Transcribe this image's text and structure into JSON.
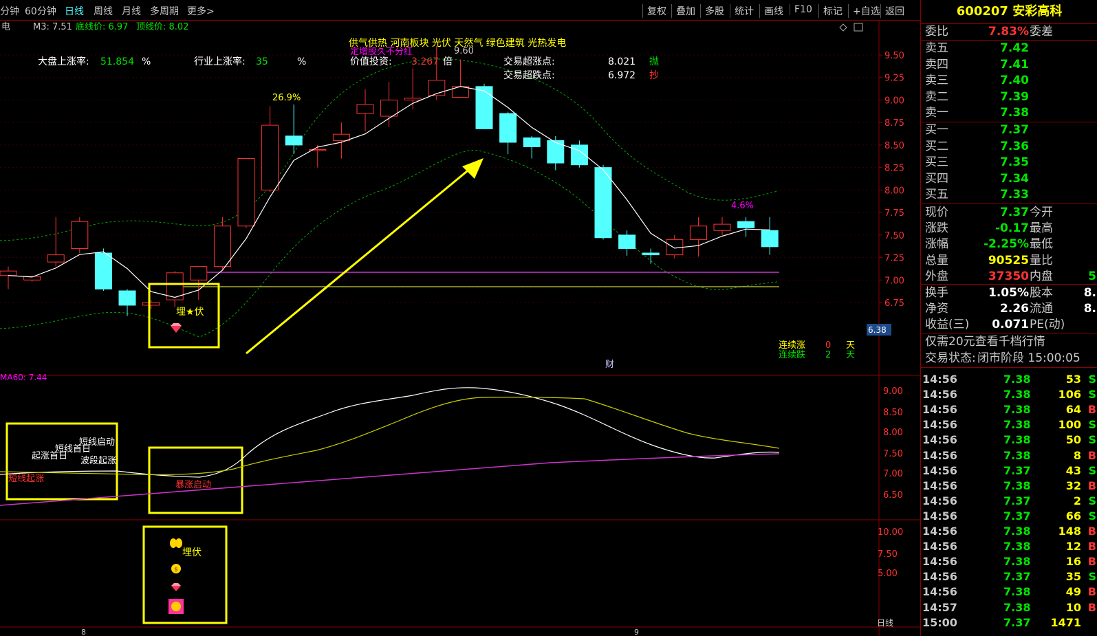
{
  "toolbar": {
    "periods": [
      "分钟",
      "60分钟",
      "日线",
      "周线",
      "月线",
      "多周期",
      "更多>"
    ],
    "active_period": "日线",
    "tools": [
      "复权",
      "叠加",
      "多股",
      "统计",
      "画线",
      "F10",
      "标记",
      "+自选",
      "返回"
    ]
  },
  "main_chart": {
    "name_prefix": "电",
    "ma_label": "M3: 7.51",
    "bottom_label": "底线价: 6.97",
    "top_label": "顶线价: 8.02",
    "market_up_label": "大盘上涨率:",
    "market_up_value": "51.854",
    "market_up_unit": "%",
    "industry_up_label": "行业上涨率:",
    "industry_up_value": "35",
    "industry_up_unit": "%",
    "concepts": "供气供热   河南板块   光伏 天然气 绿色建筑 光热发电",
    "concept_overlay": "定增股久不分红",
    "value_label": "价值投资:",
    "value_number": "3.267",
    "value_unit": "倍",
    "high_mark": "9.60",
    "overbought_label": "交易超涨点:",
    "overbought_value": "8.021",
    "overbought_tag": "抛",
    "oversold_label": "交易超跌点:",
    "oversold_value": "6.972",
    "oversold_tag": "抄",
    "pct_high": "26.9%",
    "pct_low": "4.6%",
    "bury_label": "埋★伏",
    "price_tag": "6.38",
    "streak_up_label": "连续涨",
    "streak_up_value": "0",
    "streak_up_unit": "天",
    "streak_down_label": "连续跌",
    "streak_down_value": "2",
    "streak_down_unit": "天",
    "finance_mark": "财",
    "axis": [
      "9.50",
      "9.25",
      "9.00",
      "8.75",
      "8.50",
      "8.25",
      "8.00",
      "7.75",
      "7.50",
      "7.25",
      "7.00",
      "6.75"
    ]
  },
  "sub_chart": {
    "ma_label": "MA60: 7.44",
    "labels_white": [
      "短线首日",
      "短线启动",
      "起涨首日",
      "波段起涨"
    ],
    "label_red": "短线起涨",
    "burst_label": "暴涨启动",
    "axis": [
      "9.00",
      "8.50",
      "8.00",
      "7.50",
      "7.00",
      "6.50"
    ]
  },
  "third_chart": {
    "bury_label": "埋伏",
    "axis": [
      "10.00",
      "7.50",
      "5.00"
    ],
    "period_tag": "日线",
    "date_marks": [
      "8",
      "9"
    ]
  },
  "chart_data": {
    "type": "candlestick",
    "title": "",
    "ylim": [
      6.5,
      9.75
    ],
    "candles": [
      {
        "o": 7.05,
        "h": 7.15,
        "l": 6.9,
        "c": 7.1
      },
      {
        "o": 7.0,
        "h": 7.05,
        "l": 6.98,
        "c": 7.04
      },
      {
        "o": 7.2,
        "h": 7.7,
        "l": 7.15,
        "c": 7.28
      },
      {
        "o": 7.35,
        "h": 7.7,
        "l": 7.3,
        "c": 7.65
      },
      {
        "o": 7.3,
        "h": 7.35,
        "l": 6.88,
        "c": 6.9
      },
      {
        "o": 6.88,
        "h": 6.9,
        "l": 6.6,
        "c": 6.72
      },
      {
        "o": 6.72,
        "h": 6.78,
        "l": 6.68,
        "c": 6.75
      },
      {
        "o": 6.78,
        "h": 7.1,
        "l": 6.7,
        "c": 7.08
      },
      {
        "o": 7.0,
        "h": 7.15,
        "l": 6.78,
        "c": 7.15
      },
      {
        "o": 7.15,
        "h": 7.7,
        "l": 7.12,
        "c": 7.6
      },
      {
        "o": 7.6,
        "h": 8.35,
        "l": 7.58,
        "c": 8.35
      },
      {
        "o": 8.0,
        "h": 8.93,
        "l": 7.98,
        "c": 8.72
      },
      {
        "o": 8.6,
        "h": 8.95,
        "l": 8.4,
        "c": 8.5
      },
      {
        "o": 8.45,
        "h": 8.5,
        "l": 8.25,
        "c": 8.45
      },
      {
        "o": 8.55,
        "h": 8.75,
        "l": 8.35,
        "c": 8.62
      },
      {
        "o": 8.85,
        "h": 9.12,
        "l": 8.65,
        "c": 8.95
      },
      {
        "o": 8.82,
        "h": 9.2,
        "l": 8.7,
        "c": 9.0
      },
      {
        "o": 9.0,
        "h": 9.35,
        "l": 8.9,
        "c": 9.02
      },
      {
        "o": 9.05,
        "h": 9.6,
        "l": 9.0,
        "c": 9.22
      },
      {
        "o": 9.03,
        "h": 9.45,
        "l": 9.03,
        "c": 9.15
      },
      {
        "o": 9.15,
        "h": 9.18,
        "l": 8.68,
        "c": 8.68
      },
      {
        "o": 8.85,
        "h": 8.87,
        "l": 8.4,
        "c": 8.53
      },
      {
        "o": 8.58,
        "h": 8.6,
        "l": 8.35,
        "c": 8.48
      },
      {
        "o": 8.55,
        "h": 8.6,
        "l": 8.22,
        "c": 8.3
      },
      {
        "o": 8.5,
        "h": 8.55,
        "l": 8.25,
        "c": 8.28
      },
      {
        "o": 8.25,
        "h": 8.28,
        "l": 7.45,
        "c": 7.47
      },
      {
        "o": 7.5,
        "h": 7.55,
        "l": 7.27,
        "c": 7.35
      },
      {
        "o": 7.3,
        "h": 7.35,
        "l": 7.18,
        "c": 7.28
      },
      {
        "o": 7.28,
        "h": 7.5,
        "l": 7.24,
        "c": 7.45
      },
      {
        "o": 7.45,
        "h": 7.7,
        "l": 7.26,
        "c": 7.6
      },
      {
        "o": 7.55,
        "h": 7.7,
        "l": 7.5,
        "c": 7.62
      },
      {
        "o": 7.65,
        "h": 7.7,
        "l": 7.48,
        "c": 7.58
      },
      {
        "o": 7.55,
        "h": 7.7,
        "l": 7.28,
        "c": 7.37
      }
    ]
  },
  "quote": {
    "code": "600207",
    "name": "安彩高科",
    "webi_label": "委比",
    "webi_value": "7.83%",
    "wecha_label": "委差",
    "asks": [
      {
        "label": "卖五",
        "price": "7.42"
      },
      {
        "label": "卖四",
        "price": "7.41"
      },
      {
        "label": "卖三",
        "price": "7.40"
      },
      {
        "label": "卖二",
        "price": "7.39"
      },
      {
        "label": "卖一",
        "price": "7.38"
      }
    ],
    "bids": [
      {
        "label": "买一",
        "price": "7.37"
      },
      {
        "label": "买二",
        "price": "7.36"
      },
      {
        "label": "买三",
        "price": "7.35"
      },
      {
        "label": "买四",
        "price": "7.34"
      },
      {
        "label": "买五",
        "price": "7.33"
      }
    ],
    "stats": [
      {
        "l1": "现价",
        "v1": "7.37",
        "c1": "green",
        "l2": "今开",
        "v2": ""
      },
      {
        "l1": "涨跌",
        "v1": "-0.17",
        "c1": "green",
        "l2": "最高",
        "v2": ""
      },
      {
        "l1": "涨幅",
        "v1": "-2.25%",
        "c1": "green",
        "l2": "最低",
        "v2": ""
      },
      {
        "l1": "总量",
        "v1": "90525",
        "c1": "yellow",
        "l2": "量比",
        "v2": ""
      },
      {
        "l1": "外盘",
        "v1": "37350",
        "c1": "red",
        "l2": "内盘",
        "v2": "5"
      }
    ],
    "stats2": [
      {
        "l1": "换手",
        "v1": "1.05%",
        "c1": "white",
        "l2": "股本",
        "v2": "8."
      },
      {
        "l1": "净资",
        "v1": "2.26",
        "c1": "white",
        "l2": "流通",
        "v2": "8."
      },
      {
        "l1": "收益(三)",
        "v1": "0.071",
        "c1": "white",
        "l2": "PE(动)",
        "v2": ""
      }
    ],
    "promo": "仅需20元查看千档行情",
    "status_label": "交易状态:",
    "status_value": "闭市阶段 15:00:05",
    "ticks": [
      {
        "t": "14:56",
        "p": "7.38",
        "v": "53",
        "d": "S"
      },
      {
        "t": "14:56",
        "p": "7.38",
        "v": "106",
        "d": "S"
      },
      {
        "t": "14:56",
        "p": "7.38",
        "v": "64",
        "d": "B"
      },
      {
        "t": "14:56",
        "p": "7.38",
        "v": "100",
        "d": "S"
      },
      {
        "t": "14:56",
        "p": "7.38",
        "v": "50",
        "d": "S"
      },
      {
        "t": "14:56",
        "p": "7.38",
        "v": "8",
        "d": "B"
      },
      {
        "t": "14:56",
        "p": "7.37",
        "v": "43",
        "d": "S"
      },
      {
        "t": "14:56",
        "p": "7.38",
        "v": "32",
        "d": "B"
      },
      {
        "t": "14:56",
        "p": "7.37",
        "v": "2",
        "d": "S"
      },
      {
        "t": "14:56",
        "p": "7.37",
        "v": "66",
        "d": "S"
      },
      {
        "t": "14:56",
        "p": "7.38",
        "v": "148",
        "d": "B"
      },
      {
        "t": "14:56",
        "p": "7.38",
        "v": "12",
        "d": "B"
      },
      {
        "t": "14:56",
        "p": "7.38",
        "v": "16",
        "d": "B"
      },
      {
        "t": "14:56",
        "p": "7.37",
        "v": "35",
        "d": "S"
      },
      {
        "t": "14:56",
        "p": "7.38",
        "v": "49",
        "d": "B"
      },
      {
        "t": "14:57",
        "p": "7.38",
        "v": "10",
        "d": "B"
      },
      {
        "t": "15:00",
        "p": "7.37",
        "v": "1471",
        "d": ""
      }
    ]
  }
}
